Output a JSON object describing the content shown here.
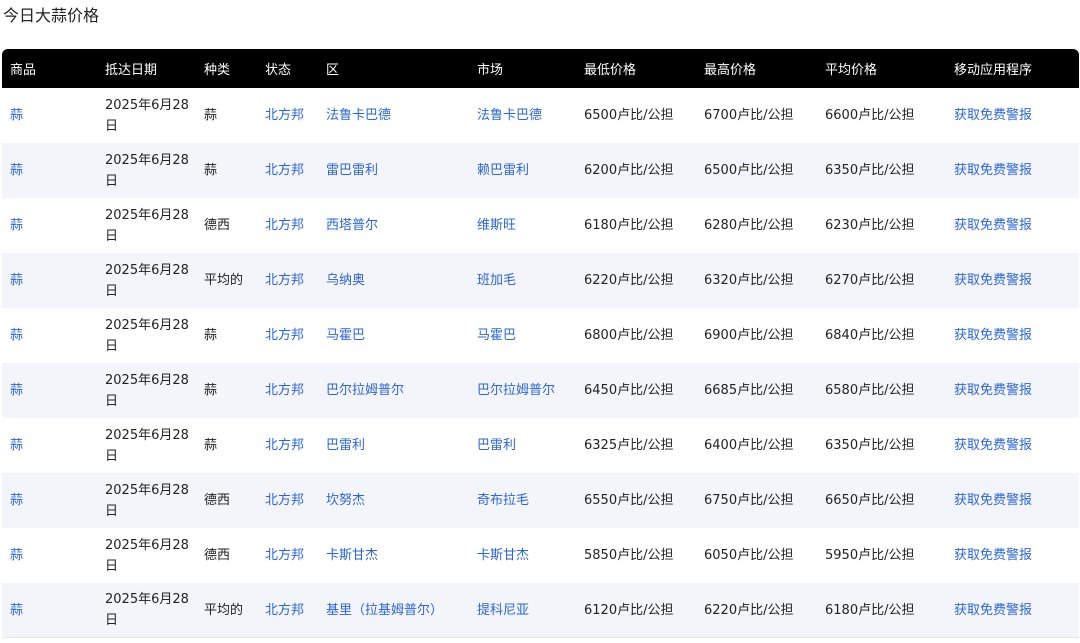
{
  "page": {
    "title": "今日大蒜价格"
  },
  "table": {
    "headers": [
      "商品",
      "抵达日期",
      "种类",
      "状态",
      "区",
      "市场",
      "最低价格",
      "最高价格",
      "平均价格",
      "移动应用程序"
    ],
    "rows": [
      {
        "commodity": "蒜",
        "date": "2025年6月28日",
        "variety": "蒜",
        "state": "北方邦",
        "district": "法鲁卡巴德",
        "market": "法鲁卡巴德",
        "min": "6500卢比/公担",
        "max": "6700卢比/公担",
        "avg": "6600卢比/公担",
        "app": "获取免费警报"
      },
      {
        "commodity": "蒜",
        "date": "2025年6月28日",
        "variety": "蒜",
        "state": "北方邦",
        "district": "雷巴雷利",
        "market": "赖巴雷利",
        "min": "6200卢比/公担",
        "max": "6500卢比/公担",
        "avg": "6350卢比/公担",
        "app": "获取免费警报"
      },
      {
        "commodity": "蒜",
        "date": "2025年6月28日",
        "variety": "德西",
        "state": "北方邦",
        "district": "西塔普尔",
        "market": "维斯旺",
        "min": "6180卢比/公担",
        "max": "6280卢比/公担",
        "avg": "6230卢比/公担",
        "app": "获取免费警报"
      },
      {
        "commodity": "蒜",
        "date": "2025年6月28日",
        "variety": "平均的",
        "state": "北方邦",
        "district": "乌纳奥",
        "market": "班加毛",
        "min": "6220卢比/公担",
        "max": "6320卢比/公担",
        "avg": "6270卢比/公担",
        "app": "获取免费警报"
      },
      {
        "commodity": "蒜",
        "date": "2025年6月28日",
        "variety": "蒜",
        "state": "北方邦",
        "district": "马霍巴",
        "market": "马霍巴",
        "min": "6800卢比/公担",
        "max": "6900卢比/公担",
        "avg": "6840卢比/公担",
        "app": "获取免费警报"
      },
      {
        "commodity": "蒜",
        "date": "2025年6月28日",
        "variety": "蒜",
        "state": "北方邦",
        "district": "巴尔拉姆普尔",
        "market": "巴尔拉姆普尔",
        "min": "6450卢比/公担",
        "max": "6685卢比/公担",
        "avg": "6580卢比/公担",
        "app": "获取免费警报"
      },
      {
        "commodity": "蒜",
        "date": "2025年6月28日",
        "variety": "蒜",
        "state": "北方邦",
        "district": "巴雷利",
        "market": "巴雷利",
        "min": "6325卢比/公担",
        "max": "6400卢比/公担",
        "avg": "6350卢比/公担",
        "app": "获取免费警报"
      },
      {
        "commodity": "蒜",
        "date": "2025年6月28日",
        "variety": "德西",
        "state": "北方邦",
        "district": "坎努杰",
        "market": "奇布拉毛",
        "min": "6550卢比/公担",
        "max": "6750卢比/公担",
        "avg": "6650卢比/公担",
        "app": "获取免费警报"
      },
      {
        "commodity": "蒜",
        "date": "2025年6月28日",
        "variety": "德西",
        "state": "北方邦",
        "district": "卡斯甘杰",
        "market": "卡斯甘杰",
        "min": "5850卢比/公担",
        "max": "6050卢比/公担",
        "avg": "5950卢比/公担",
        "app": "获取免费警报"
      },
      {
        "commodity": "蒜",
        "date": "2025年6月28日",
        "variety": "平均的",
        "state": "北方邦",
        "district": "基里（拉基姆普尔）",
        "market": "提科尼亚",
        "min": "6120卢比/公担",
        "max": "6220卢比/公担",
        "avg": "6180卢比/公担",
        "app": "获取免费警报"
      }
    ]
  },
  "colors": {
    "header_bg": "#000000",
    "link": "#2a66d9",
    "row_alt": "#f4f5fa"
  }
}
